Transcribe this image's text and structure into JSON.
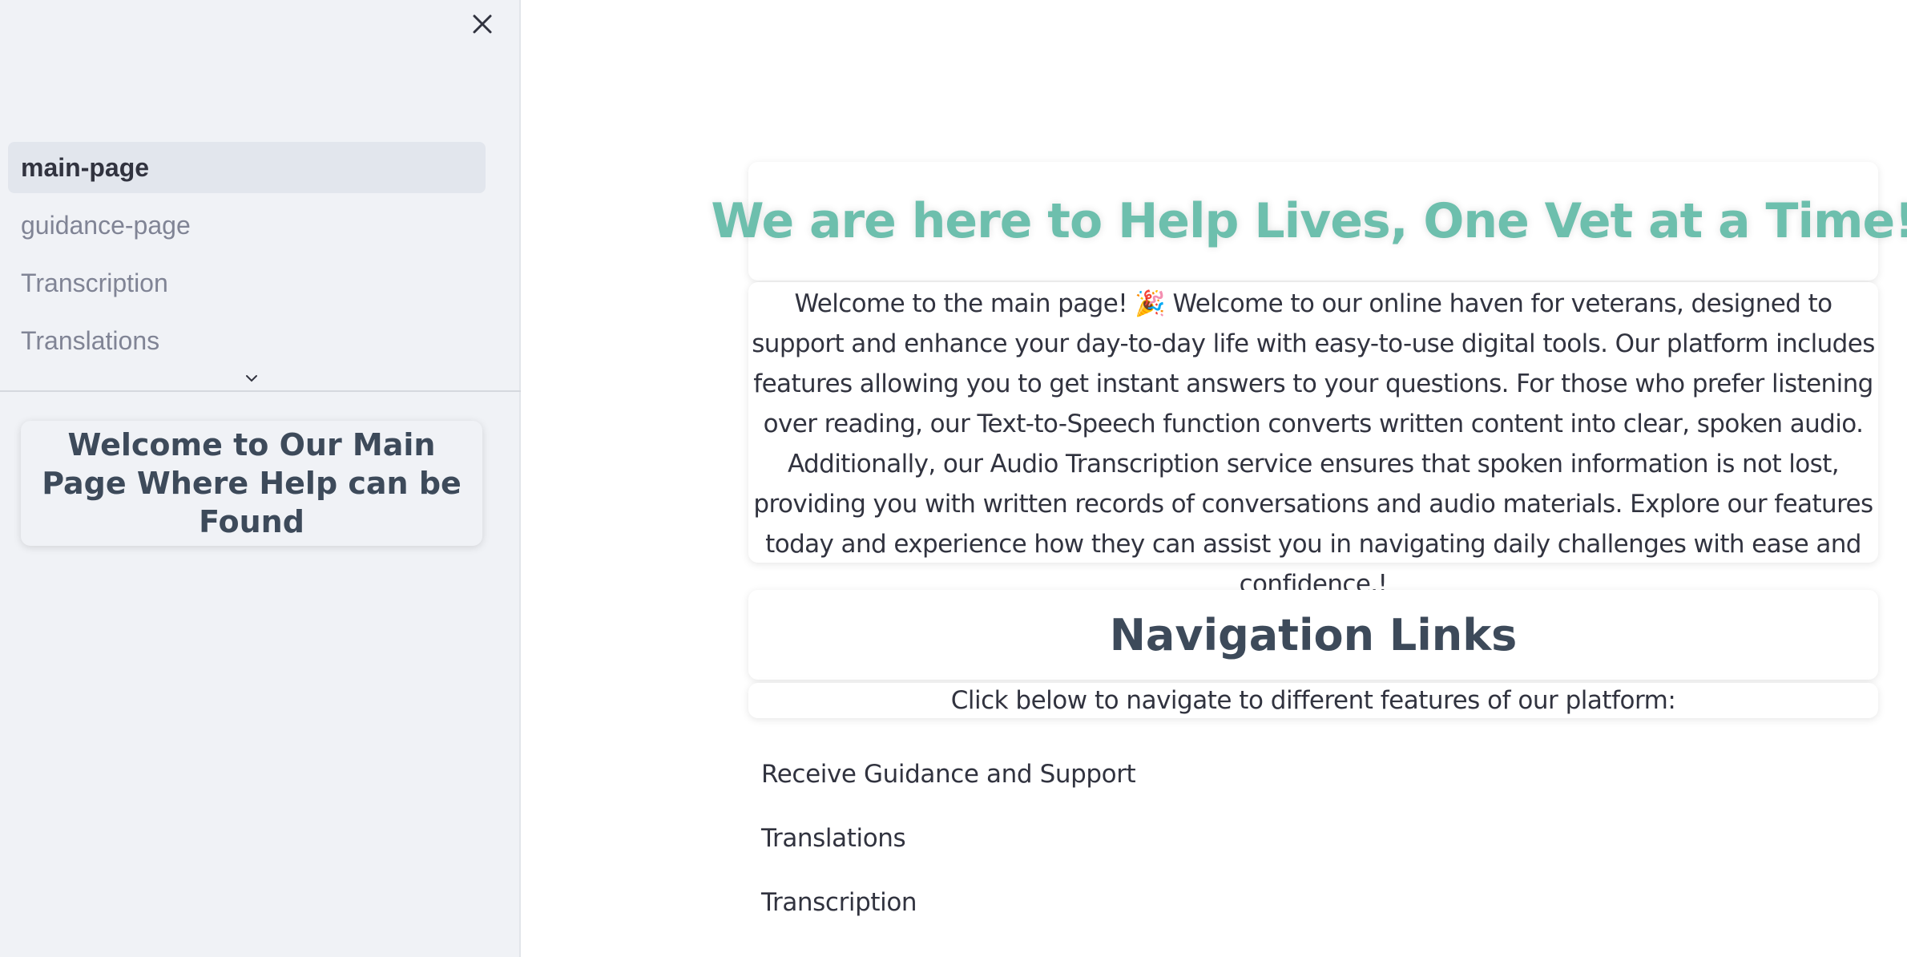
{
  "sidebar": {
    "nav_items": [
      {
        "label": "main-page",
        "active": true
      },
      {
        "label": "guidance-page",
        "active": false
      },
      {
        "label": "Transcription",
        "active": false
      },
      {
        "label": "Translations",
        "active": false
      }
    ],
    "card_title": "Welcome to Our Main Page Where Help can be Found"
  },
  "main": {
    "hero_title": "We are here to Help Lives, One Vet at a Time!",
    "intro_text": "Welcome to the main page! 🎉 Welcome to our online haven for veterans, designed to support and enhance your day-to-day life with easy-to-use digital tools. Our platform includes features allowing you to get instant answers to your questions. For those who prefer listening over reading, our Text-to-Speech function converts written content into clear, spoken audio. Additionally, our Audio Transcription service ensures that spoken information is not lost, providing you with written records of conversations and audio materials. Explore our features today and experience how they can assist you in navigating daily challenges with ease and confidence.!",
    "nav_header": "Navigation Links",
    "nav_subtitle": "Click below to navigate to different features of our platform:",
    "links": [
      {
        "label": "Receive Guidance and Support"
      },
      {
        "label": "Translations"
      },
      {
        "label": "Transcription"
      }
    ]
  },
  "colors": {
    "sidebar_bg": "#f0f2f6",
    "hero_accent": "#6dbfad",
    "heading_text": "#3d4a5a",
    "body_text": "#31333f"
  },
  "icons": {
    "close": "close-icon",
    "expand": "chevron-down-icon"
  }
}
